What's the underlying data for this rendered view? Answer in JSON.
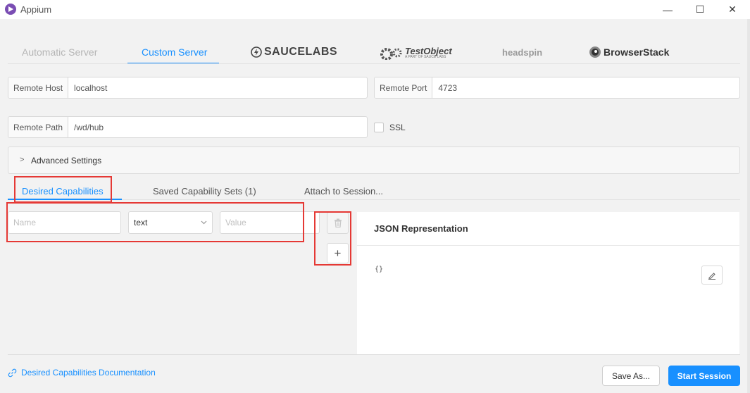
{
  "window": {
    "title": "Appium",
    "controls": {
      "minimize": "—",
      "maximize": "☐",
      "close": "✕"
    }
  },
  "provider_tabs": [
    {
      "label": "Automatic Server",
      "active": false
    },
    {
      "label": "Custom Server",
      "active": true
    }
  ],
  "providers": {
    "saucelabs": "SAUCELABS",
    "testobject": "TestObject",
    "testobject_sub": "A PART OF SAUCE LABS",
    "headspin": "headspin",
    "browserstack": "BrowserStack"
  },
  "server": {
    "remote_host_label": "Remote Host",
    "remote_host_value": "localhost",
    "remote_port_label": "Remote Port",
    "remote_port_value": "4723",
    "remote_path_label": "Remote Path",
    "remote_path_value": "/wd/hub",
    "ssl_label": "SSL",
    "ssl_checked": false
  },
  "advanced": {
    "chevron": ">",
    "label": "Advanced Settings"
  },
  "capability_tabs": [
    {
      "label": "Desired Capabilities",
      "active": true
    },
    {
      "label": "Saved Capability Sets (1)",
      "active": false
    },
    {
      "label": "Attach to Session...",
      "active": false
    }
  ],
  "capability_row": {
    "name_placeholder": "Name",
    "type_value": "text",
    "value_placeholder": "Value"
  },
  "icons": {
    "delete": "trash-icon",
    "add": "plus-icon",
    "edit": "pencil-icon",
    "link": "link-icon",
    "dropdown": "chevron-down-icon"
  },
  "add_symbol": "+",
  "json_panel": {
    "title": "JSON Representation",
    "content": "{}"
  },
  "footer": {
    "doc_link": "Desired Capabilities Documentation",
    "save_as": "Save As...",
    "start_session": "Start Session"
  },
  "colors": {
    "accent": "#1890ff",
    "highlight": "#e53935",
    "app_icon": "#7a4db3"
  }
}
